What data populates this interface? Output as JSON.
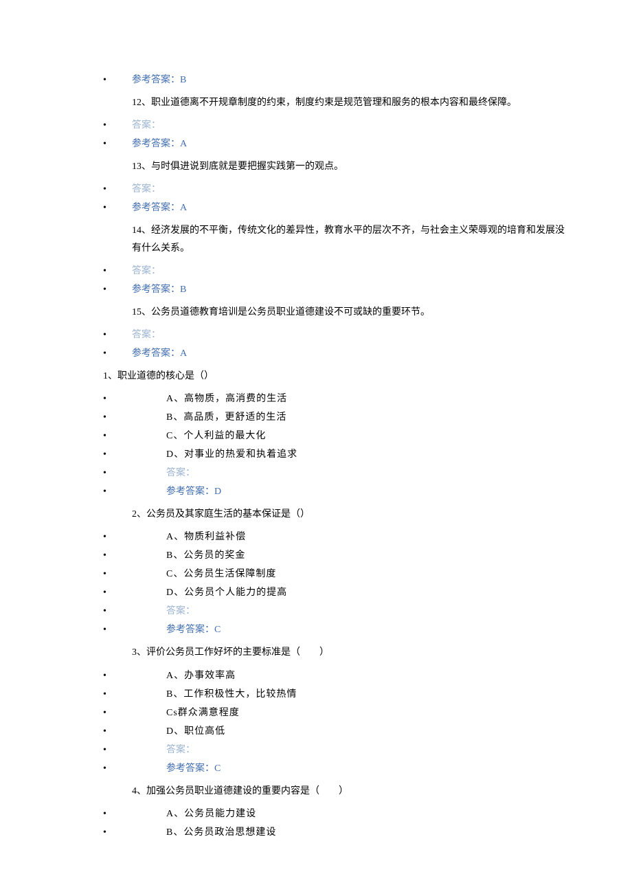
{
  "bullet": "•",
  "ref_answer": "参考答案：",
  "user_answer": "答案：",
  "tf": [
    {
      "num": "12",
      "text": "12、职业道德离不开规章制度的约束，制度约束是规范管理和服务的根本内容和最终保障。",
      "ref": "A",
      "prev_ref": "B"
    },
    {
      "num": "13",
      "text": "13、与时俱进说到底就是要把握实践第一的观点。",
      "ref": "A"
    },
    {
      "num": "14",
      "text": "14、经济发展的不平衡，传统文化的差异性，教育水平的层次不齐，与社会主义荣辱观的培育和发展没有什么关系。",
      "ref": "B"
    },
    {
      "num": "15",
      "text": "15、公务员道德教育培训是公务员职业道德建设不可或缺的重要环节。",
      "ref": "A"
    }
  ],
  "mc_first": {
    "text": "1、职业道德的核心是（）",
    "opts": [
      "A、高物质，高消费的生活",
      "B、高品质，更舒适的生活",
      "C、个人利益的最大化",
      "D、对事业的热爱和执着追求"
    ],
    "ref": "D"
  },
  "mc": [
    {
      "text": "2、公务员及其家庭生活的基本保证是（）",
      "opts": [
        "A、物质利益补偿",
        "B、公务员的奖金",
        "C、公务员生活保障制度",
        "D、公务员个人能力的提高"
      ],
      "ref": "C"
    },
    {
      "text": "3、评价公务员工作好坏的主要标准是（　　）",
      "opts": [
        "A、办事效率高",
        "B、工作积极性大，比较热情",
        "Cs群众满意程度",
        "D、职位高低"
      ],
      "ref": "C"
    },
    {
      "text": "4、加强公务员职业道德建设的重要内容是（　　）",
      "opts": [
        "A、公务员能力建设",
        "B、公务员政治思想建设"
      ],
      "ref": null
    }
  ]
}
